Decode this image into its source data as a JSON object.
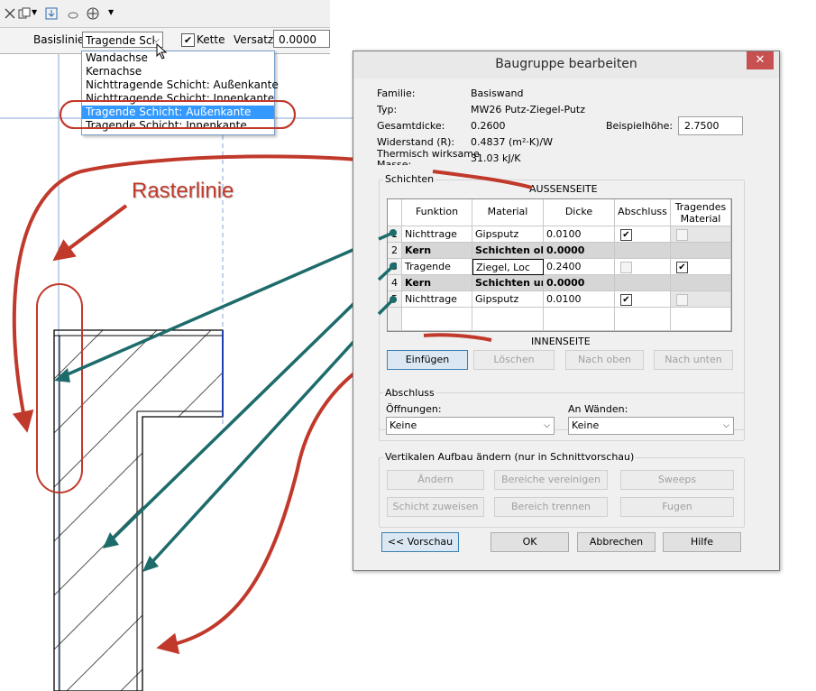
{
  "optionsbar": {
    "basislinie_label": "Basislinie:",
    "basislinie_value": "Tragende Scl",
    "kette_label": "Kette",
    "kette_checked": "✔",
    "versatz_label": "Versatz:",
    "versatz_value": "0.0000"
  },
  "dropdown": {
    "items": [
      "Wandachse",
      "Kernachse",
      "Nichttragende Schicht: Außenkante",
      "Nichttragende Schicht: Innenkante",
      "Tragende Schicht: Außenkante",
      "Tragende Schicht: Innenkante"
    ],
    "selected_index": 4
  },
  "annotation": {
    "rasterlinie": "Rasterlinie",
    "color": "#c0392b"
  },
  "dialog": {
    "title": "Baugruppe bearbeiten",
    "close": "✕",
    "familie_label": "Familie:",
    "familie_value": "Basiswand",
    "typ_label": "Typ:",
    "typ_value": "MW26 Putz-Ziegel-Putz",
    "gesamtdicke_label": "Gesamtdicke:",
    "gesamtdicke_value": "0.2600",
    "beispielhoehe_label": "Beispielhöhe:",
    "beispielhoehe_value": "2.7500",
    "widerstand_label": "Widerstand (R):",
    "widerstand_value": "0.4837 (m²·K)/W",
    "thermisch_label": "Thermisch wirksame",
    "masse_label": "Masse:",
    "thermisch_value": "31.03 kJ/K",
    "schichten_label": "Schichten",
    "aussenseite": "AUSSENSEITE",
    "innenseite": "INNENSEITE",
    "columns": [
      "Funktion",
      "Material",
      "Dicke",
      "Abschluss",
      "Tragendes Material"
    ],
    "col_last_line1": "Tragendes",
    "col_last_line2": "Material",
    "rows": [
      {
        "num": "1",
        "funktion": "Nichttrage",
        "material": "Gipsputz",
        "dicke": "0.0100",
        "abschluss": "✔",
        "tragend": ""
      },
      {
        "num": "2",
        "funktion": "Kern",
        "material": "Schichten ob",
        "dicke": "0.0000",
        "abschluss": "",
        "tragend": ""
      },
      {
        "num": "3",
        "funktion": "Tragende",
        "material": "Ziegel, Loc",
        "dicke": "0.2400",
        "abschluss": "",
        "tragend": "✔"
      },
      {
        "num": "4",
        "funktion": "Kern",
        "material": "Schichten un",
        "dicke": "0.0000",
        "abschluss": "",
        "tragend": ""
      },
      {
        "num": "5",
        "funktion": "Nichttrage",
        "material": "Gipsputz",
        "dicke": "0.0100",
        "abschluss": "✔",
        "tragend": ""
      }
    ],
    "btn_einfuegen": "Einfügen",
    "btn_loeschen": "Löschen",
    "btn_nach_oben": "Nach oben",
    "btn_nach_unten": "Nach unten",
    "abschluss_label": "Abschluss",
    "oeffnungen_label": "Öffnungen:",
    "oeffnungen_value": "Keine",
    "an_waenden_label": "An Wänden:",
    "an_waenden_value": "Keine",
    "vertikal_label": "Vertikalen Aufbau ändern (nur in Schnittvorschau)",
    "btn_aendern": "Ändern",
    "btn_bereiche_vereinigen": "Bereiche vereinigen",
    "btn_sweeps": "Sweeps",
    "btn_schicht_zuweisen": "Schicht zuweisen",
    "btn_bereich_trennen": "Bereich trennen",
    "btn_fugen": "Fugen",
    "btn_vorschau": "<< Vorschau",
    "btn_ok": "OK",
    "btn_abbrechen": "Abbrechen",
    "btn_hilfe": "Hilfe"
  }
}
